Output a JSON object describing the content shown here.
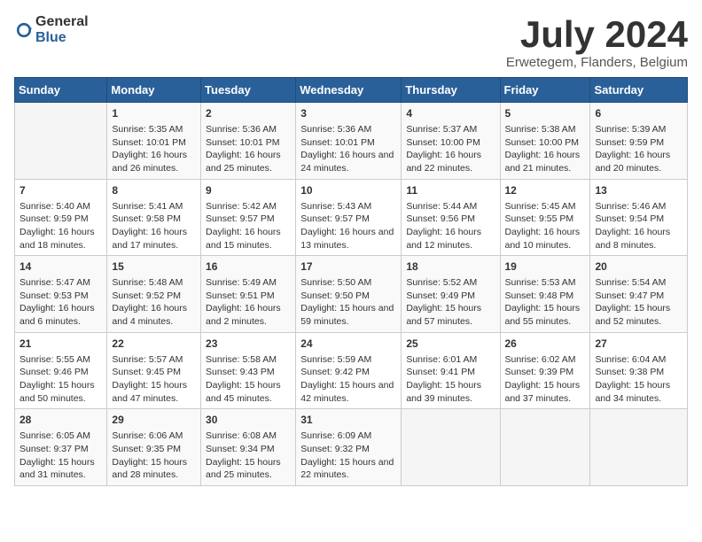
{
  "header": {
    "logo_general": "General",
    "logo_blue": "Blue",
    "month": "July 2024",
    "location": "Erwetegem, Flanders, Belgium"
  },
  "days_of_week": [
    "Sunday",
    "Monday",
    "Tuesday",
    "Wednesday",
    "Thursday",
    "Friday",
    "Saturday"
  ],
  "weeks": [
    [
      {
        "day": "",
        "sunrise": "",
        "sunset": "",
        "daylight": "",
        "empty": true
      },
      {
        "day": "1",
        "sunrise": "Sunrise: 5:35 AM",
        "sunset": "Sunset: 10:01 PM",
        "daylight": "Daylight: 16 hours and 26 minutes."
      },
      {
        "day": "2",
        "sunrise": "Sunrise: 5:36 AM",
        "sunset": "Sunset: 10:01 PM",
        "daylight": "Daylight: 16 hours and 25 minutes."
      },
      {
        "day": "3",
        "sunrise": "Sunrise: 5:36 AM",
        "sunset": "Sunset: 10:01 PM",
        "daylight": "Daylight: 16 hours and 24 minutes."
      },
      {
        "day": "4",
        "sunrise": "Sunrise: 5:37 AM",
        "sunset": "Sunset: 10:00 PM",
        "daylight": "Daylight: 16 hours and 22 minutes."
      },
      {
        "day": "5",
        "sunrise": "Sunrise: 5:38 AM",
        "sunset": "Sunset: 10:00 PM",
        "daylight": "Daylight: 16 hours and 21 minutes."
      },
      {
        "day": "6",
        "sunrise": "Sunrise: 5:39 AM",
        "sunset": "Sunset: 9:59 PM",
        "daylight": "Daylight: 16 hours and 20 minutes."
      }
    ],
    [
      {
        "day": "7",
        "sunrise": "Sunrise: 5:40 AM",
        "sunset": "Sunset: 9:59 PM",
        "daylight": "Daylight: 16 hours and 18 minutes."
      },
      {
        "day": "8",
        "sunrise": "Sunrise: 5:41 AM",
        "sunset": "Sunset: 9:58 PM",
        "daylight": "Daylight: 16 hours and 17 minutes."
      },
      {
        "day": "9",
        "sunrise": "Sunrise: 5:42 AM",
        "sunset": "Sunset: 9:57 PM",
        "daylight": "Daylight: 16 hours and 15 minutes."
      },
      {
        "day": "10",
        "sunrise": "Sunrise: 5:43 AM",
        "sunset": "Sunset: 9:57 PM",
        "daylight": "Daylight: 16 hours and 13 minutes."
      },
      {
        "day": "11",
        "sunrise": "Sunrise: 5:44 AM",
        "sunset": "Sunset: 9:56 PM",
        "daylight": "Daylight: 16 hours and 12 minutes."
      },
      {
        "day": "12",
        "sunrise": "Sunrise: 5:45 AM",
        "sunset": "Sunset: 9:55 PM",
        "daylight": "Daylight: 16 hours and 10 minutes."
      },
      {
        "day": "13",
        "sunrise": "Sunrise: 5:46 AM",
        "sunset": "Sunset: 9:54 PM",
        "daylight": "Daylight: 16 hours and 8 minutes."
      }
    ],
    [
      {
        "day": "14",
        "sunrise": "Sunrise: 5:47 AM",
        "sunset": "Sunset: 9:53 PM",
        "daylight": "Daylight: 16 hours and 6 minutes."
      },
      {
        "day": "15",
        "sunrise": "Sunrise: 5:48 AM",
        "sunset": "Sunset: 9:52 PM",
        "daylight": "Daylight: 16 hours and 4 minutes."
      },
      {
        "day": "16",
        "sunrise": "Sunrise: 5:49 AM",
        "sunset": "Sunset: 9:51 PM",
        "daylight": "Daylight: 16 hours and 2 minutes."
      },
      {
        "day": "17",
        "sunrise": "Sunrise: 5:50 AM",
        "sunset": "Sunset: 9:50 PM",
        "daylight": "Daylight: 15 hours and 59 minutes."
      },
      {
        "day": "18",
        "sunrise": "Sunrise: 5:52 AM",
        "sunset": "Sunset: 9:49 PM",
        "daylight": "Daylight: 15 hours and 57 minutes."
      },
      {
        "day": "19",
        "sunrise": "Sunrise: 5:53 AM",
        "sunset": "Sunset: 9:48 PM",
        "daylight": "Daylight: 15 hours and 55 minutes."
      },
      {
        "day": "20",
        "sunrise": "Sunrise: 5:54 AM",
        "sunset": "Sunset: 9:47 PM",
        "daylight": "Daylight: 15 hours and 52 minutes."
      }
    ],
    [
      {
        "day": "21",
        "sunrise": "Sunrise: 5:55 AM",
        "sunset": "Sunset: 9:46 PM",
        "daylight": "Daylight: 15 hours and 50 minutes."
      },
      {
        "day": "22",
        "sunrise": "Sunrise: 5:57 AM",
        "sunset": "Sunset: 9:45 PM",
        "daylight": "Daylight: 15 hours and 47 minutes."
      },
      {
        "day": "23",
        "sunrise": "Sunrise: 5:58 AM",
        "sunset": "Sunset: 9:43 PM",
        "daylight": "Daylight: 15 hours and 45 minutes."
      },
      {
        "day": "24",
        "sunrise": "Sunrise: 5:59 AM",
        "sunset": "Sunset: 9:42 PM",
        "daylight": "Daylight: 15 hours and 42 minutes."
      },
      {
        "day": "25",
        "sunrise": "Sunrise: 6:01 AM",
        "sunset": "Sunset: 9:41 PM",
        "daylight": "Daylight: 15 hours and 39 minutes."
      },
      {
        "day": "26",
        "sunrise": "Sunrise: 6:02 AM",
        "sunset": "Sunset: 9:39 PM",
        "daylight": "Daylight: 15 hours and 37 minutes."
      },
      {
        "day": "27",
        "sunrise": "Sunrise: 6:04 AM",
        "sunset": "Sunset: 9:38 PM",
        "daylight": "Daylight: 15 hours and 34 minutes."
      }
    ],
    [
      {
        "day": "28",
        "sunrise": "Sunrise: 6:05 AM",
        "sunset": "Sunset: 9:37 PM",
        "daylight": "Daylight: 15 hours and 31 minutes."
      },
      {
        "day": "29",
        "sunrise": "Sunrise: 6:06 AM",
        "sunset": "Sunset: 9:35 PM",
        "daylight": "Daylight: 15 hours and 28 minutes."
      },
      {
        "day": "30",
        "sunrise": "Sunrise: 6:08 AM",
        "sunset": "Sunset: 9:34 PM",
        "daylight": "Daylight: 15 hours and 25 minutes."
      },
      {
        "day": "31",
        "sunrise": "Sunrise: 6:09 AM",
        "sunset": "Sunset: 9:32 PM",
        "daylight": "Daylight: 15 hours and 22 minutes."
      },
      {
        "day": "",
        "sunrise": "",
        "sunset": "",
        "daylight": "",
        "empty": true
      },
      {
        "day": "",
        "sunrise": "",
        "sunset": "",
        "daylight": "",
        "empty": true
      },
      {
        "day": "",
        "sunrise": "",
        "sunset": "",
        "daylight": "",
        "empty": true
      }
    ]
  ]
}
